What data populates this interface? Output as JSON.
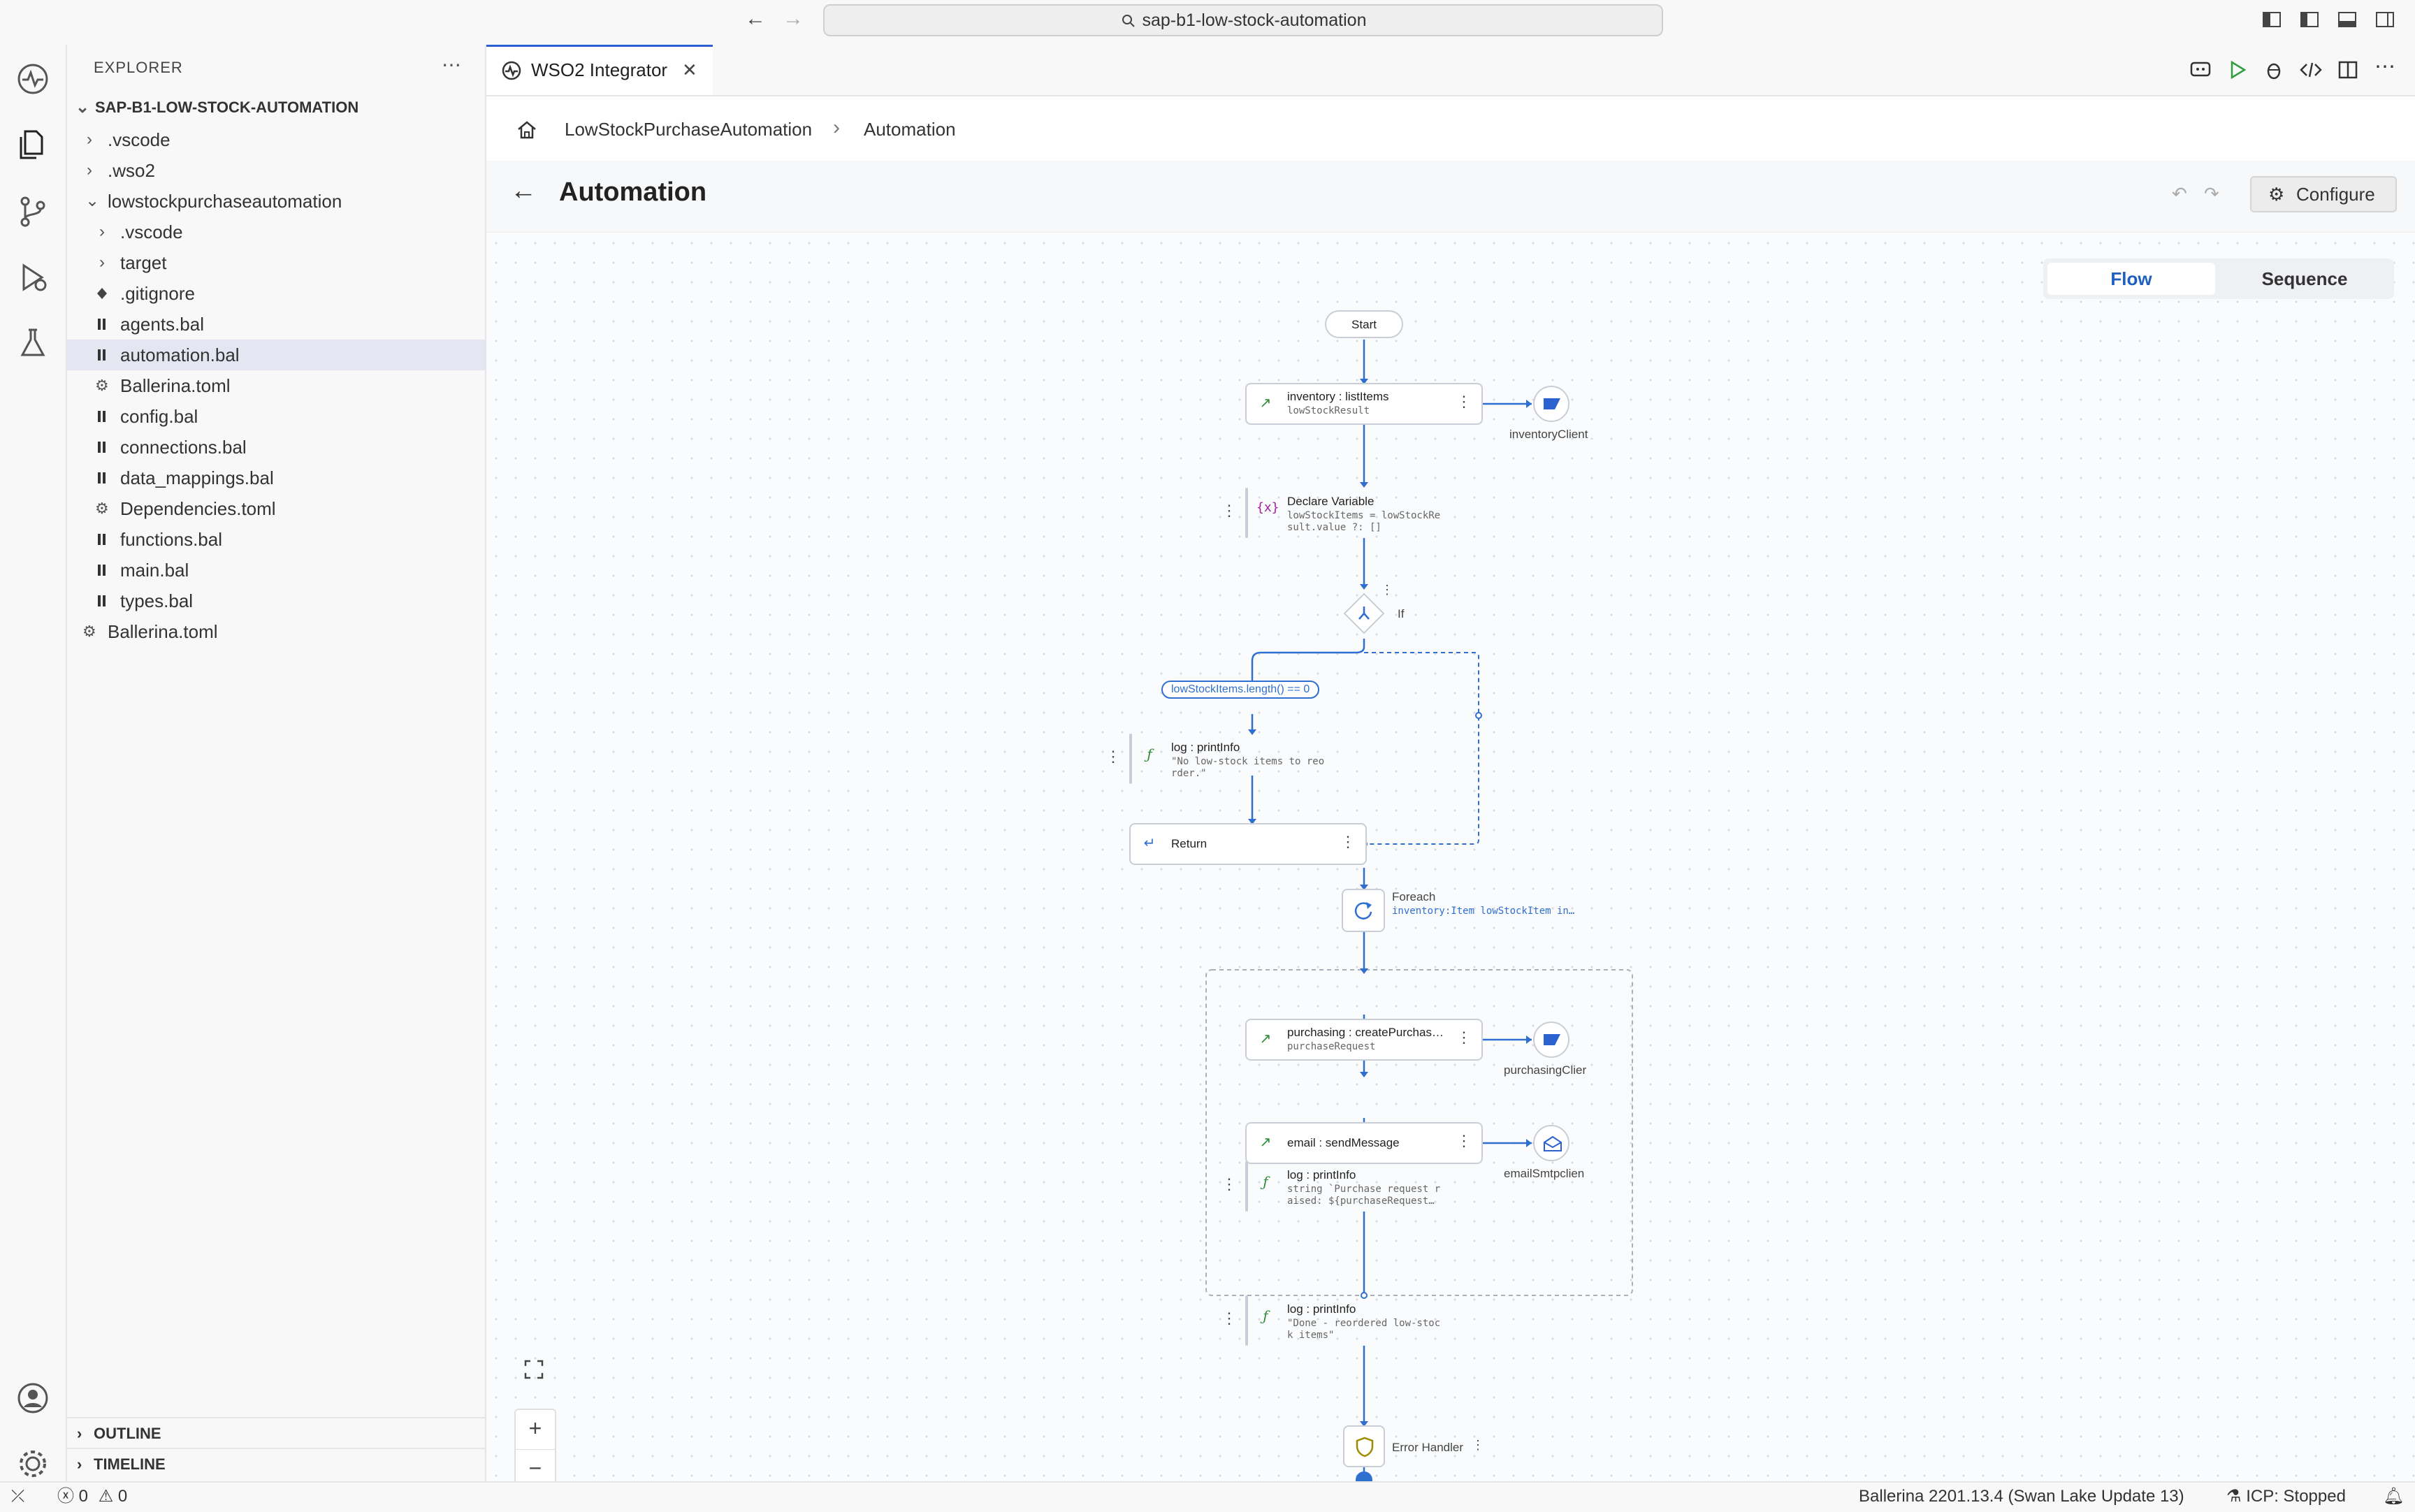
{
  "window": {
    "search_text": "sap-b1-low-stock-automation"
  },
  "explorer": {
    "title": "EXPLORER",
    "project": "SAP-B1-LOW-STOCK-AUTOMATION",
    "items": [
      {
        "label": ".vscode"
      },
      {
        "label": ".wso2"
      },
      {
        "label": "lowstockpurchaseautomation"
      },
      {
        "label": ".vscode"
      },
      {
        "label": "target"
      },
      {
        "label": ".gitignore"
      },
      {
        "label": "agents.bal"
      },
      {
        "label": "automation.bal"
      },
      {
        "label": "Ballerina.toml"
      },
      {
        "label": "config.bal"
      },
      {
        "label": "connections.bal"
      },
      {
        "label": "data_mappings.bal"
      },
      {
        "label": "Dependencies.toml"
      },
      {
        "label": "functions.bal"
      },
      {
        "label": "main.bal"
      },
      {
        "label": "types.bal"
      },
      {
        "label": "Ballerina.toml"
      }
    ],
    "outline": "OUTLINE",
    "timeline": "TIMELINE"
  },
  "tab": {
    "label": "WSO2 Integrator"
  },
  "breadcrumb": {
    "first": "LowStockPurchaseAutomation",
    "second": "Automation"
  },
  "page": {
    "title": "Automation",
    "configure_label": "Configure"
  },
  "view_toggle": {
    "flow": "Flow",
    "sequence": "Sequence",
    "active": "Flow"
  },
  "flow": {
    "start": "Start",
    "n1": {
      "title": "inventory : listItems",
      "sub": "lowStockResult"
    },
    "n1_conn": "inventoryClient",
    "n2": {
      "title": "Declare Variable",
      "sub1": "lowStockItems = lowStockRe",
      "sub2": "sult.value ?: []"
    },
    "if_label": "If",
    "condition": "lowStockItems.length() == 0",
    "n3": {
      "title": "log : printInfo",
      "sub1": "\"No low-stock items to reo",
      "sub2": "rder.\""
    },
    "n4": {
      "title": "Return"
    },
    "foreach": {
      "title": "Foreach",
      "sub": "inventory:Item lowStockItem in…"
    },
    "n5": {
      "title": "purchasing : createPurchas…",
      "sub": "purchaseRequest"
    },
    "n5_conn": "purchasingClier",
    "n6": {
      "title": "email : sendMessage"
    },
    "n6_conn": "emailSmtpclien",
    "n7": {
      "title": "log : printInfo",
      "sub1": "string `Purchase request r",
      "sub2": "aised: ${purchaseRequest…"
    },
    "n8": {
      "title": "log : printInfo",
      "sub1": "\"Done - reordered low-stoc",
      "sub2": "k items\""
    },
    "error_handler": "Error Handler"
  },
  "status": {
    "errors": "0",
    "warnings": "0",
    "ballerina": "Ballerina 2201.13.4 (Swan Lake Update 13)",
    "icp": "ICP: Stopped"
  },
  "colors": {
    "accent": "#2b61d1",
    "flow_line": "#2f6fd0",
    "function_icon": "#2e8b3a",
    "variable_icon": "#a020a0"
  }
}
